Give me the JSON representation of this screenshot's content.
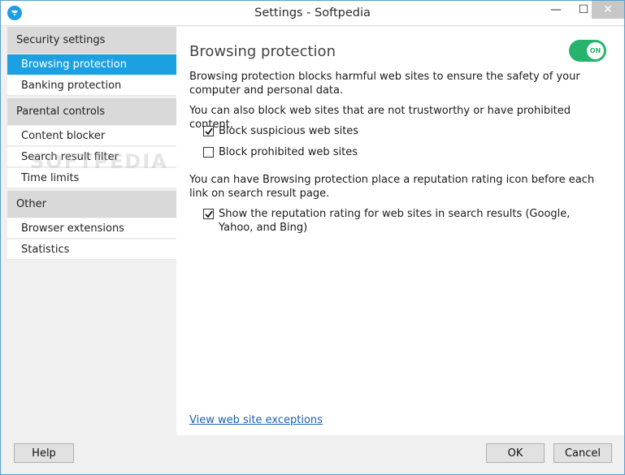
{
  "window": {
    "title": "Settings - Softpedia",
    "app_icon": "shield-icon",
    "controls": {
      "minimize": "—",
      "maximize": "☐",
      "close": "✕"
    }
  },
  "sidebar": {
    "sections": [
      {
        "header": "Security settings",
        "items": [
          {
            "label": "Browsing protection",
            "active": true
          },
          {
            "label": "Banking protection",
            "active": false
          }
        ]
      },
      {
        "header": "Parental controls",
        "items": [
          {
            "label": "Content blocker",
            "active": false
          },
          {
            "label": "Search result filter",
            "active": false
          },
          {
            "label": "Time limits",
            "active": false
          }
        ]
      },
      {
        "header": "Other",
        "items": [
          {
            "label": "Browser extensions",
            "active": false
          },
          {
            "label": "Statistics",
            "active": false
          }
        ]
      }
    ]
  },
  "main": {
    "title": "Browsing protection",
    "toggle": {
      "label": "ON",
      "on": true,
      "color": "#27b36b"
    },
    "description": "Browsing protection blocks harmful web sites to ensure the safety of your computer and personal data.",
    "block_intro": "You can also block web sites that are not trustworthy or have prohibited content.",
    "options": [
      {
        "label": "Block suspicious web sites",
        "checked": true
      },
      {
        "label": "Block prohibited web sites",
        "checked": false
      }
    ],
    "rating_intro": "You can have Browsing protection place a reputation rating icon before each link on search result page.",
    "rating_option": {
      "label": "Show the reputation rating for web sites in search results (Google, Yahoo, and Bing)",
      "checked": true
    },
    "exceptions_link": "View web site exceptions"
  },
  "footer": {
    "help": "Help",
    "ok": "OK",
    "cancel": "Cancel"
  },
  "watermark": "SOFTPEDIA",
  "colors": {
    "accent": "#1ba1e2",
    "section_bg": "#d9d9d9",
    "link": "#1a5fb4"
  }
}
